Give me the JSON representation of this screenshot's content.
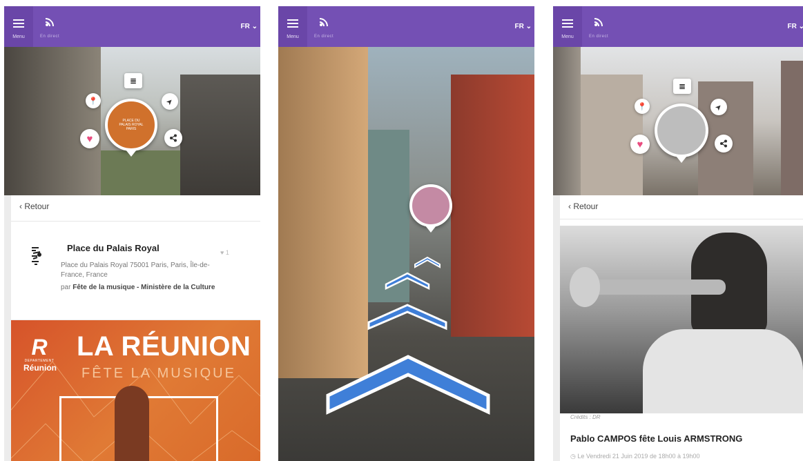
{
  "header": {
    "menu_label": "Menu",
    "live_label": "En direct",
    "lang": "FR ⌄"
  },
  "screen1": {
    "back_label": "‹ Retour",
    "poi_caption": "PLACE DU PALAIS ROYAL PARIS",
    "title": "Place du Palais Royal",
    "address": "Place du Palais Royal 75001 Paris, Paris, Île-de-France, France",
    "by_prefix": "par ",
    "by_org": "Fête de la musique - Ministère de la Culture",
    "likes": "♥ 1",
    "poster": {
      "title": "LA RÉUNION",
      "subtitle": "FÊTE LA MUSIQUE",
      "logo_letter": "R",
      "logo_dept": "DEPARTEMENT",
      "logo_name": "Réunion"
    }
  },
  "screen3": {
    "back_label": "‹ Retour",
    "credits": "Crédits : DR",
    "title": "Pablo CAMPOS fête Louis ARMSTRONG",
    "date": "◷ Le Vendredi 21 Juin 2019 de 18h00 à 19h00"
  },
  "icons": {
    "list": "≣",
    "pin": "📍",
    "heart": "♥",
    "navigate": "➤",
    "share": "⮕"
  },
  "colors": {
    "header": "#7450b4",
    "accent_pink": "#e94c7f",
    "accent_yellow": "#f4c21e",
    "arrow_blue": "#3f7fd8"
  }
}
